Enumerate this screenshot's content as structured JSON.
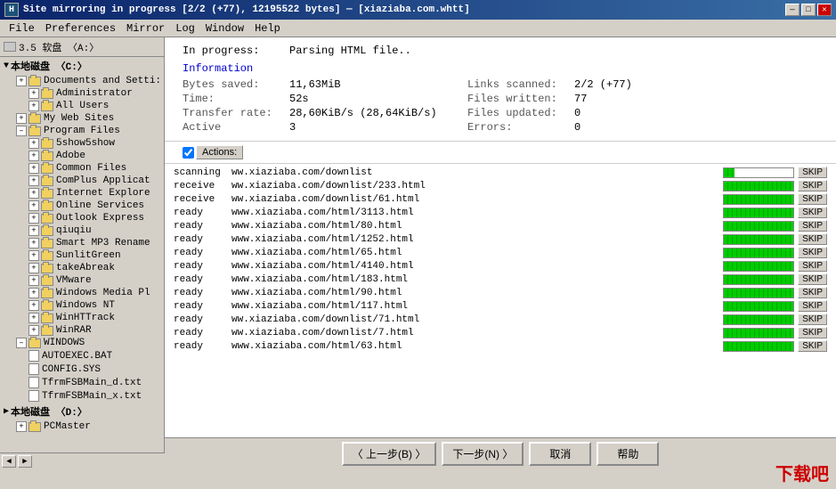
{
  "titlebar": {
    "icon": "H",
    "title": "Site mirroring in progress [2/2 (+77), 12195522 bytes] — [xiaziaba.com.whtt]",
    "buttons": [
      "—",
      "□",
      "✕"
    ]
  },
  "menubar": {
    "items": [
      "File",
      "Preferences",
      "Mirror",
      "Log",
      "Window",
      "Help"
    ]
  },
  "toolbar": {
    "drive_label": "3.5 软盘 〈A:〉"
  },
  "progress": {
    "label": "In progress:",
    "value": "Parsing HTML file..",
    "info_title": "Information",
    "fields": [
      {
        "label": "Bytes saved:",
        "value": "11,63MiB"
      },
      {
        "label": "Links scanned:",
        "value": "2/2 (+77)"
      },
      {
        "label": "Time:",
        "value": "52s"
      },
      {
        "label": "Files written:",
        "value": "77"
      },
      {
        "label": "Transfer rate:",
        "value": "28,60KiB/s (28,64KiB/s)"
      },
      {
        "label": "Files updated:",
        "value": "0"
      },
      {
        "label": "Active",
        "value": "3"
      },
      {
        "label": "Errors:",
        "value": "0"
      }
    ]
  },
  "actions": {
    "checkbox_checked": true,
    "button_label": "Actions:"
  },
  "downloads": [
    {
      "status": "scanning",
      "url": "ww.xiaziaba.com/downlist",
      "progress": 15,
      "skip": "SKIP"
    },
    {
      "status": "receive",
      "url": "ww.xiaziaba.com/downlist/233.html",
      "progress": 100,
      "skip": "SKIP"
    },
    {
      "status": "receive",
      "url": "ww.xiaziaba.com/downlist/61.html",
      "progress": 100,
      "skip": "SKIP"
    },
    {
      "status": "ready",
      "url": "www.xiaziaba.com/html/3113.html",
      "progress": 100,
      "skip": "SKIP"
    },
    {
      "status": "ready",
      "url": "www.xiaziaba.com/html/80.html",
      "progress": 100,
      "skip": "SKIP"
    },
    {
      "status": "ready",
      "url": "www.xiaziaba.com/html/1252.html",
      "progress": 100,
      "skip": "SKIP"
    },
    {
      "status": "ready",
      "url": "www.xiaziaba.com/html/65.html",
      "progress": 100,
      "skip": "SKIP"
    },
    {
      "status": "ready",
      "url": "www.xiaziaba.com/html/4140.html",
      "progress": 100,
      "skip": "SKIP"
    },
    {
      "status": "ready",
      "url": "www.xiaziaba.com/html/183.html",
      "progress": 100,
      "skip": "SKIP"
    },
    {
      "status": "ready",
      "url": "www.xiaziaba.com/html/90.html",
      "progress": 100,
      "skip": "SKIP"
    },
    {
      "status": "ready",
      "url": "www.xiaziaba.com/html/117.html",
      "progress": 100,
      "skip": "SKIP"
    },
    {
      "status": "ready",
      "url": "ww.xiaziaba.com/downlist/71.html",
      "progress": 100,
      "skip": "SKIP"
    },
    {
      "status": "ready",
      "url": "ww.xiaziaba.com/downlist/7.html",
      "progress": 100,
      "skip": "SKIP"
    },
    {
      "status": "ready",
      "url": "www.xiaziaba.com/html/63.html",
      "progress": 100,
      "skip": "SKIP"
    }
  ],
  "bottom_buttons": {
    "prev": "〈 上一步(B) 〉",
    "next": "下一步(N) 〉",
    "cancel": "取消",
    "help": "帮助"
  },
  "tree": {
    "drive_a": "3.5 软盘 〈A:〉",
    "drive_c": "本地磁盘 〈C:〉",
    "drive_d": "本地磁盘 〈D:〉",
    "folders": [
      {
        "name": "Documents and Setti:",
        "level": 2,
        "expanded": true
      },
      {
        "name": "Administrator",
        "level": 3
      },
      {
        "name": "All Users",
        "level": 3
      },
      {
        "name": "My Web Sites",
        "level": 2
      },
      {
        "name": "Program Files",
        "level": 2,
        "expanded": true
      },
      {
        "name": "5show5show",
        "level": 3
      },
      {
        "name": "Adobe",
        "level": 3
      },
      {
        "name": "Common Files",
        "level": 3
      },
      {
        "name": "ComPlus Applicat",
        "level": 3
      },
      {
        "name": "Internet Explore",
        "level": 3
      },
      {
        "name": "Online Services",
        "level": 3
      },
      {
        "name": "Outlook Express",
        "level": 3
      },
      {
        "name": "qiuqiu",
        "level": 3
      },
      {
        "name": "Smart MP3 Rename",
        "level": 3
      },
      {
        "name": "SunlitGreen",
        "level": 3
      },
      {
        "name": "takeAbreak",
        "level": 3
      },
      {
        "name": "VMware",
        "level": 3
      },
      {
        "name": "Windows Media Pl",
        "level": 3
      },
      {
        "name": "Windows NT",
        "level": 3
      },
      {
        "name": "WinHTTrack",
        "level": 3
      },
      {
        "name": "WinRAR",
        "level": 3
      },
      {
        "name": "WINDOWS",
        "level": 2,
        "expanded": true
      },
      {
        "name": "AUTOEXEC.BAT",
        "level": 3,
        "type": "file"
      },
      {
        "name": "CONFIG.SYS",
        "level": 3,
        "type": "file"
      },
      {
        "name": "TfrmFSBMain_d.txt",
        "level": 3,
        "type": "file"
      },
      {
        "name": "TfrmFSBMain_x.txt",
        "level": 3,
        "type": "file"
      }
    ],
    "subfolder": "PCMaster"
  },
  "colors": {
    "accent_blue": "#0000cc",
    "progress_green": "#00cc00",
    "title_blue": "#0a246a"
  }
}
